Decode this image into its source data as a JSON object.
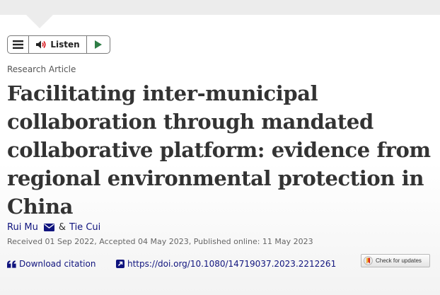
{
  "toolbar": {
    "listen_label": "Listen"
  },
  "article": {
    "type": "Research Article",
    "title_lines": [
      "Facilitating inter-municipal",
      "collaboration through mandated",
      "collaborative platform: evidence from",
      "regional environmental protection in",
      "China"
    ],
    "authors": {
      "first": "Rui Mu",
      "separator": "&",
      "second": "Tie Cui"
    },
    "dates": "Received 01 Sep 2022, Accepted 04 May 2023, Published online: 11 May 2023"
  },
  "actions": {
    "download_citation": "Download citation",
    "doi": "https://doi.org/10.1080/14719037.2023.2212261",
    "check_updates": "Check for updates"
  },
  "colors": {
    "link": "#10147e",
    "title": "#333333",
    "play": "#2f7d45",
    "top_band": "#ececec"
  }
}
